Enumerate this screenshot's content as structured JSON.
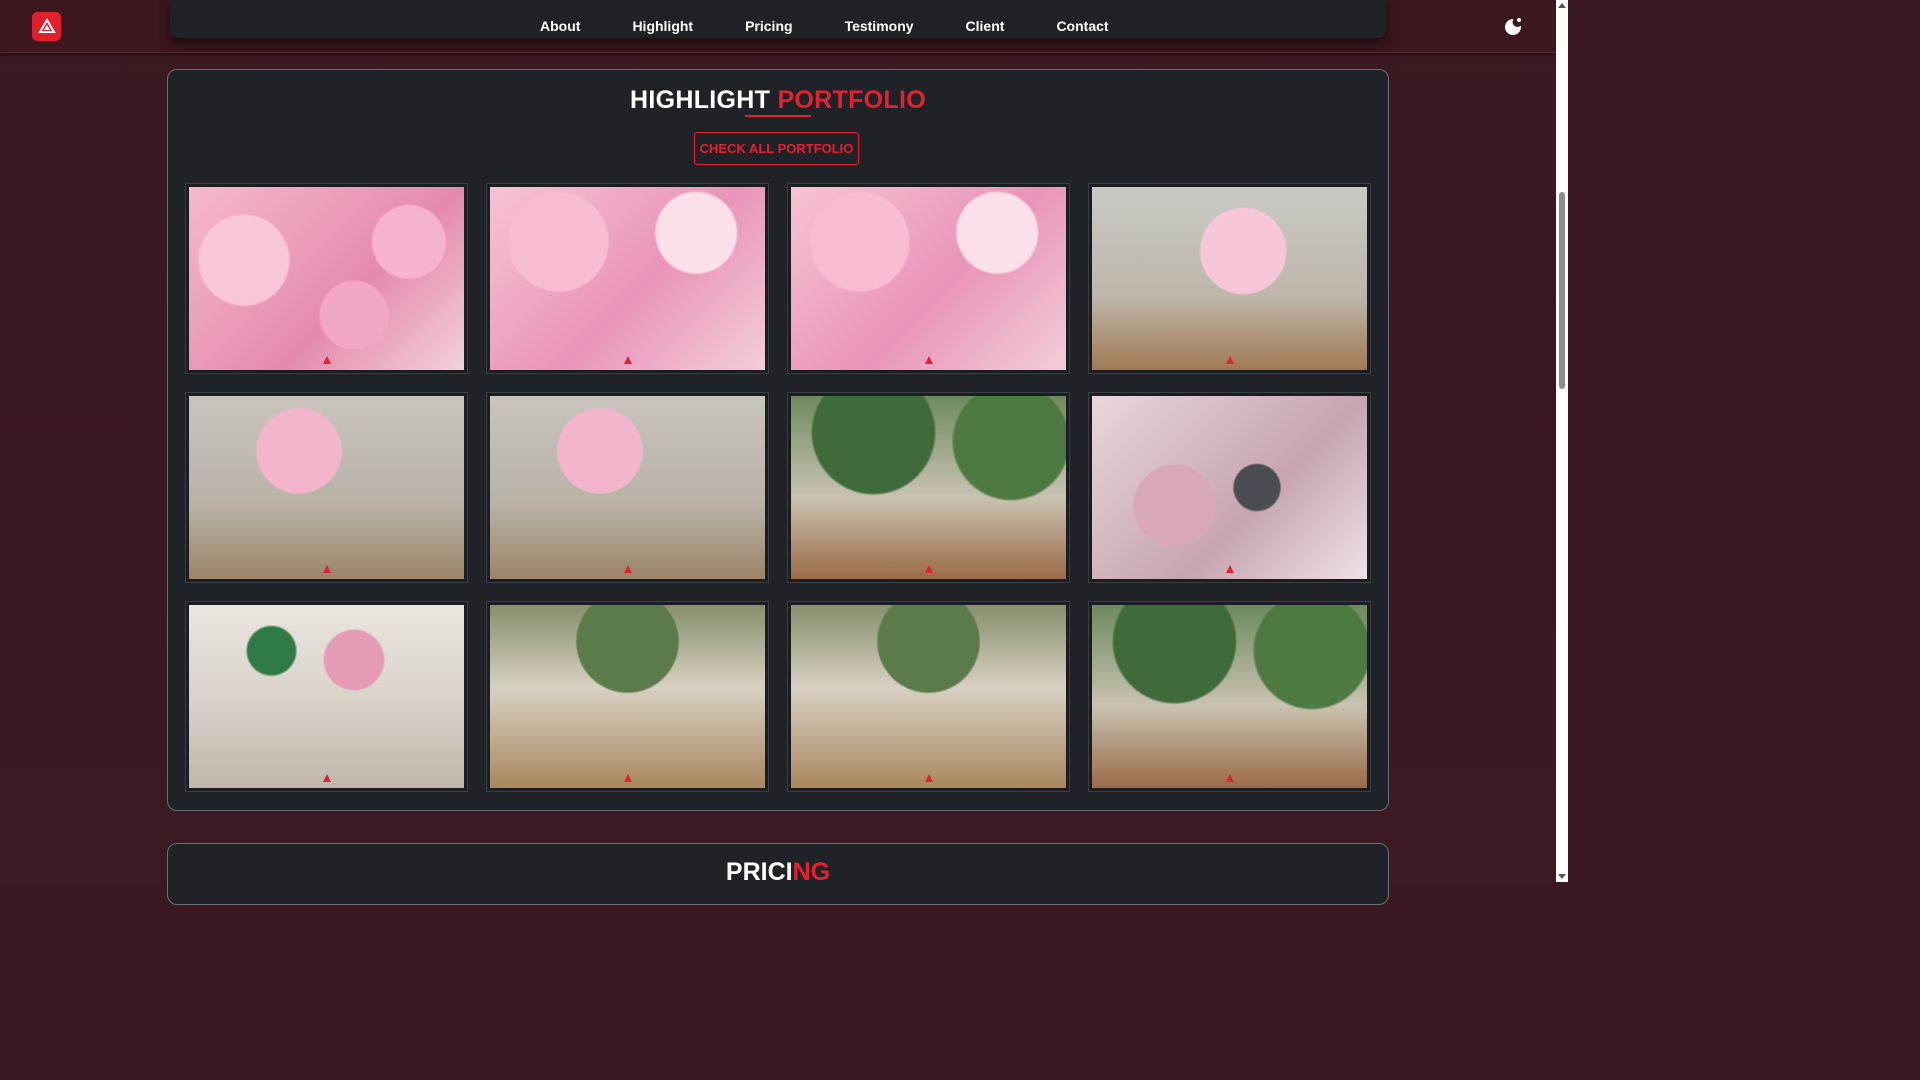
{
  "nav": {
    "links": [
      "About",
      "Highlight",
      "Pricing",
      "Testimony",
      "Client",
      "Contact"
    ]
  },
  "portfolio": {
    "title_part1": "HIGHLIGHT",
    "title_part2": "PORTFOLIO",
    "button_label": "CHECK ALL PORTFOLIO",
    "photos": [
      {
        "scene": "birthday-cake-mila-sign"
      },
      {
        "scene": "birthday-cake-closeup"
      },
      {
        "scene": "birthday-cake-happy-birthday-topper"
      },
      {
        "scene": "decorated-stage-17-sign"
      },
      {
        "scene": "family-on-stage"
      },
      {
        "scene": "guests-watching-stage"
      },
      {
        "scene": "garden-venue-interior"
      },
      {
        "scene": "hanging-polaroid-photos"
      },
      {
        "scene": "dining-table-setting"
      },
      {
        "scene": "guests-at-dining-table"
      },
      {
        "scene": "guests-in-garden-hall"
      },
      {
        "scene": "full-hall-with-guests"
      }
    ]
  },
  "next_section": {
    "title_part1": "PRICI",
    "title_part2": "NG"
  },
  "colors": {
    "accent": "#e32230",
    "card_bg": "#1f2328",
    "page_bg": "#3a1820"
  }
}
